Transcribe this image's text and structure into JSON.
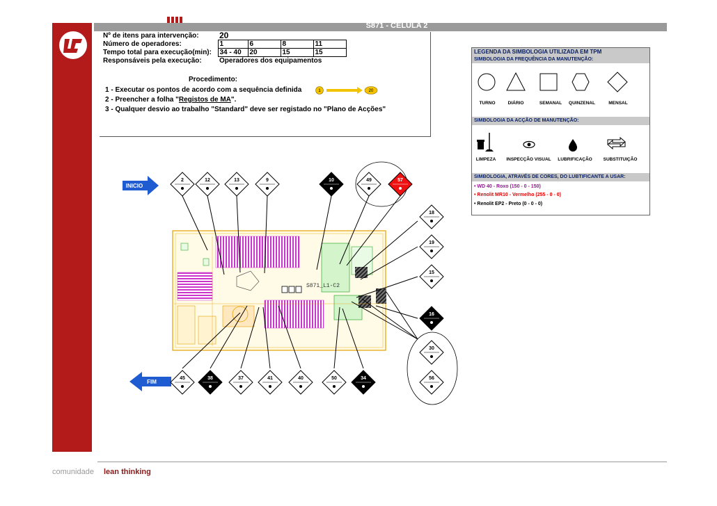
{
  "header": {
    "title": "S871 - CÉLULA 2"
  },
  "info": {
    "rows": [
      {
        "label": "Nº de itens para intervenção:",
        "values": [
          "20"
        ]
      },
      {
        "label": "Número de operadores:",
        "values": [
          "1",
          "6",
          "8",
          "11"
        ]
      },
      {
        "label": "Tempo total para execução(min):",
        "values": [
          "34 - 40",
          "20",
          "15",
          "15"
        ]
      },
      {
        "label": "Responsáveis pela execução:",
        "values": [
          "Operadores dos equipamentos"
        ]
      }
    ],
    "procedure_title": "Procedimento:",
    "steps": {
      "s1": "1 - Executar os pontos de acordo com a sequência definida",
      "s1_from": "1",
      "s1_to": "20",
      "s2_pre": "2 - Preencher a folha \"",
      "s2_link": "Registos de MA",
      "s2_post": "\".",
      "s3": "3 - Qualquer desvio ao trabalho \"Standard\" deve ser registado no \"Plano de Acções\""
    }
  },
  "legend": {
    "title": "LEGENDA DA SIMBOLOGIA UTILIZADA EM TPM",
    "frequency_title": "SIMBOLOGIA DA FREQUÊNCIA DA MANUTENÇÃO:",
    "frequency": [
      "TURNO",
      "DIÁRIO",
      "SEMANAL",
      "QUINZENAL",
      "MENSAL"
    ],
    "action_title": "SIMBOLOGIA DA ACÇÃO DE MANUTENÇÃO:",
    "actions": [
      "LIMPEZA",
      "INSPECÇÃO VISUAL",
      "LUBRIFICAÇÃO",
      "SUBSTITUIÇÃO"
    ],
    "colors_title": "SIMBOLOGIA, ATRAVÉS DE CORES, DO LUBTIFICANTE A USAR:",
    "lubricants": [
      {
        "text": "• WD 40 - Roxo (150 - 0 - 150)",
        "color": "#9a0f9a"
      },
      {
        "text": "• Renolit MR10 - Vermelho (255 - 0 - 0)",
        "color": "#e00000"
      },
      {
        "text": "• Renolit EP2 - Preto (0 - 0 - 0)",
        "color": "#000000"
      }
    ]
  },
  "diagram": {
    "start_label": "INICIO",
    "end_label": "FIM",
    "layout_label": "S871_L1-C2",
    "points": [
      {
        "num": "2",
        "style": "white"
      },
      {
        "num": "12",
        "style": "white"
      },
      {
        "num": "13",
        "style": "white"
      },
      {
        "num": "9",
        "style": "white"
      },
      {
        "num": "10",
        "style": "black"
      },
      {
        "num": "49",
        "style": "white"
      },
      {
        "num": "57",
        "style": "red"
      },
      {
        "num": "18",
        "style": "white"
      },
      {
        "num": "19",
        "style": "white"
      },
      {
        "num": "15",
        "style": "white"
      },
      {
        "num": "16",
        "style": "black"
      },
      {
        "num": "30",
        "style": "white"
      },
      {
        "num": "56",
        "style": "white"
      },
      {
        "num": "45",
        "style": "white"
      },
      {
        "num": "38",
        "style": "black"
      },
      {
        "num": "37",
        "style": "white"
      },
      {
        "num": "41",
        "style": "white"
      },
      {
        "num": "40",
        "style": "white"
      },
      {
        "num": "50",
        "style": "white"
      },
      {
        "num": "34",
        "style": "black"
      }
    ]
  },
  "colors": {
    "accent_red": "#b31b1b",
    "arrow_blue": "#1f5bd1",
    "link_yellow": "#f3c300",
    "purple": "#cc33cc"
  },
  "footer": {
    "left": "comunidade",
    "right": "lean thinking"
  }
}
